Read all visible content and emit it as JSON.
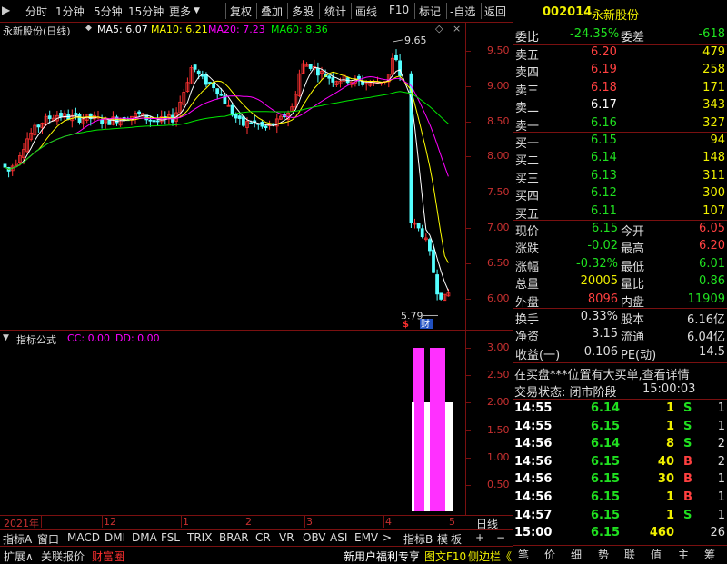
{
  "toolbar": {
    "left": [
      "分时",
      "1分钟",
      "5分钟",
      "15分钟",
      "更多"
    ],
    "right": [
      "复权",
      "叠加",
      "多股",
      "统计",
      "画线",
      "F10",
      "标记",
      "-自选",
      "返回"
    ]
  },
  "chart": {
    "stock": "永新股份(日线)",
    "ma5": "MA5: 6.07",
    "ma10": "MA10: 6.21",
    "ma20": "MA20: 7.23",
    "ma60": "MA60: 8.36",
    "high_mark": "9.65",
    "low_mark": "5.79",
    "marker_s": "$",
    "marker_cai": "财",
    "price_ticks": [
      "9.50",
      "9.00",
      "8.50",
      "8.00",
      "7.50",
      "7.00",
      "6.50",
      "6.00"
    ],
    "colors": {
      "up": "#ff3232",
      "down": "#54ffff",
      "ma5": "#ffffff",
      "ma10": "#ffff00",
      "ma20": "#ff00ff",
      "ma60": "#00e600"
    }
  },
  "indicator": {
    "title": "指标公式",
    "cc": "CC: 0.00",
    "dd": "DD: 0.00",
    "ticks": [
      "3.00",
      "2.50",
      "2.00",
      "1.50",
      "1.00",
      "0.50"
    ]
  },
  "xaxis": {
    "labels": [
      "2021年",
      "12",
      "1",
      "2",
      "3",
      "4",
      "5"
    ],
    "period": "日线"
  },
  "tabs_row1": [
    "指标A",
    "窗口",
    "MACD",
    "DMI",
    "DMA",
    "FSL",
    "TRIX",
    "BRAR",
    "CR",
    "VR",
    "OBV",
    "ASI",
    "EMV",
    ">"
  ],
  "tabs_row1_right": [
    "指标B",
    "模",
    "板",
    "+",
    "−"
  ],
  "tabs_row2": [
    "扩展∧",
    "关联报价",
    "财富圈"
  ],
  "tabs_row2_right": [
    "新用户福利专享",
    "图文F10",
    "侧边栏《"
  ],
  "quote": {
    "code": "002014",
    "name": "永新股份",
    "weibi_label": "委比",
    "weibi": "-24.35%",
    "weicha_label": "委差",
    "weicha": "-618",
    "asks": [
      {
        "label": "卖五",
        "price": "6.20",
        "vol": "479"
      },
      {
        "label": "卖四",
        "price": "6.19",
        "vol": "258"
      },
      {
        "label": "卖三",
        "price": "6.18",
        "vol": "171"
      },
      {
        "label": "卖二",
        "price": "6.17",
        "vol": "343"
      },
      {
        "label": "卖一",
        "price": "6.16",
        "vol": "327"
      }
    ],
    "bids": [
      {
        "label": "买一",
        "price": "6.15",
        "vol": "94"
      },
      {
        "label": "买二",
        "price": "6.14",
        "vol": "148"
      },
      {
        "label": "买三",
        "price": "6.13",
        "vol": "311"
      },
      {
        "label": "买四",
        "price": "6.12",
        "vol": "300"
      },
      {
        "label": "买五",
        "price": "6.11",
        "vol": "107"
      }
    ],
    "stats": [
      {
        "l1": "现价",
        "v1": "6.15",
        "l2": "今开",
        "v2": "6.05"
      },
      {
        "l1": "涨跌",
        "v1": "-0.02",
        "l2": "最高",
        "v2": "6.20"
      },
      {
        "l1": "涨幅",
        "v1": "-0.32%",
        "l2": "最低",
        "v2": "6.01"
      },
      {
        "l1": "总量",
        "v1": "20005",
        "l2": "量比",
        "v2": "0.86"
      },
      {
        "l1": "外盘",
        "v1": "8096",
        "l2": "内盘",
        "v2": "11909"
      }
    ],
    "stats2": [
      {
        "l1": "换手",
        "v1": "0.33%",
        "l2": "股本",
        "v2": "6.16亿"
      },
      {
        "l1": "净资",
        "v1": "3.15",
        "l2": "流通",
        "v2": "6.04亿"
      },
      {
        "l1": "收益(一)",
        "v1": "0.106",
        "l2": "PE(动)",
        "v2": "14.5"
      }
    ],
    "notice": "在买盘***位置有大买单,查看详情",
    "status_label": "交易状态: 闭市阶段",
    "status_time": "15:00:03",
    "ticks": [
      {
        "time": "14:55",
        "price": "6.14",
        "vol": "1",
        "bs": "S",
        "n": "1"
      },
      {
        "time": "14:55",
        "price": "6.15",
        "vol": "1",
        "bs": "S",
        "n": "1"
      },
      {
        "time": "14:56",
        "price": "6.14",
        "vol": "8",
        "bs": "S",
        "n": "2"
      },
      {
        "time": "14:56",
        "price": "6.15",
        "vol": "40",
        "bs": "B",
        "n": "2"
      },
      {
        "time": "14:56",
        "price": "6.15",
        "vol": "30",
        "bs": "B",
        "n": "1"
      },
      {
        "time": "14:56",
        "price": "6.15",
        "vol": "1",
        "bs": "B",
        "n": "1"
      },
      {
        "time": "14:57",
        "price": "6.15",
        "vol": "1",
        "bs": "S",
        "n": "1"
      },
      {
        "time": "15:00",
        "price": "6.15",
        "vol": "460",
        "bs": "",
        "n": "26"
      }
    ],
    "bottom_tabs": [
      "笔",
      "价",
      "细",
      "势",
      "联",
      "值",
      "主",
      "筹"
    ]
  }
}
